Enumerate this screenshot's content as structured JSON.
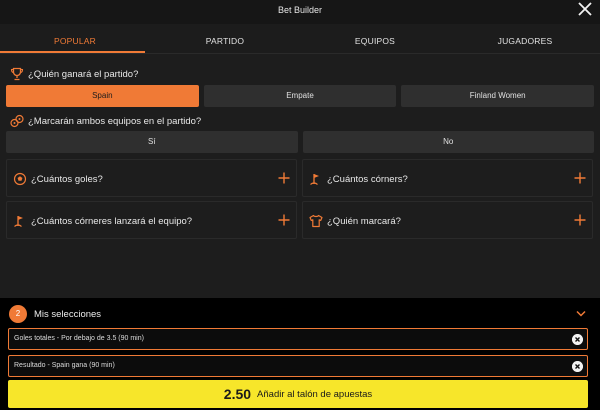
{
  "header": {
    "title": "Bet Builder"
  },
  "tabs": [
    {
      "label": "POPULAR",
      "active": true
    },
    {
      "label": "PARTIDO",
      "active": false
    },
    {
      "label": "EQUIPOS",
      "active": false
    },
    {
      "label": "JUGADORES",
      "active": false
    }
  ],
  "winner": {
    "question": "¿Quién ganará el partido?",
    "icon": "trophy-icon",
    "options": [
      "Spain",
      "Empate",
      "Finland Women"
    ],
    "selected": "Spain"
  },
  "btts": {
    "question": "¿Marcarán ambos equipos en el partido?",
    "icon": "soccer-balls-icon",
    "options": [
      "Sí",
      "No"
    ]
  },
  "markets": [
    {
      "label": "¿Cuántos goles?",
      "icon": "ball-icon"
    },
    {
      "label": "¿Cuántos córners?",
      "icon": "corner-flag-icon"
    },
    {
      "label": "¿Cuántos córneres lanzará el equipo?",
      "icon": "corner-flag-icon"
    },
    {
      "label": "¿Quién marcará?",
      "icon": "shirt-icon"
    }
  ],
  "selections": {
    "count": "2",
    "title": "Mis selecciones",
    "items": [
      "Goles totales - Por debajo de 3.5 (90 min)",
      "Resultado - Spain gana (90 min)"
    ]
  },
  "cta": {
    "odds": "2.50",
    "label": "Añadir al talón de apuestas"
  },
  "colors": {
    "accent": "#f07a36",
    "cta": "#f7e62a",
    "background": "#1d1d1d"
  }
}
